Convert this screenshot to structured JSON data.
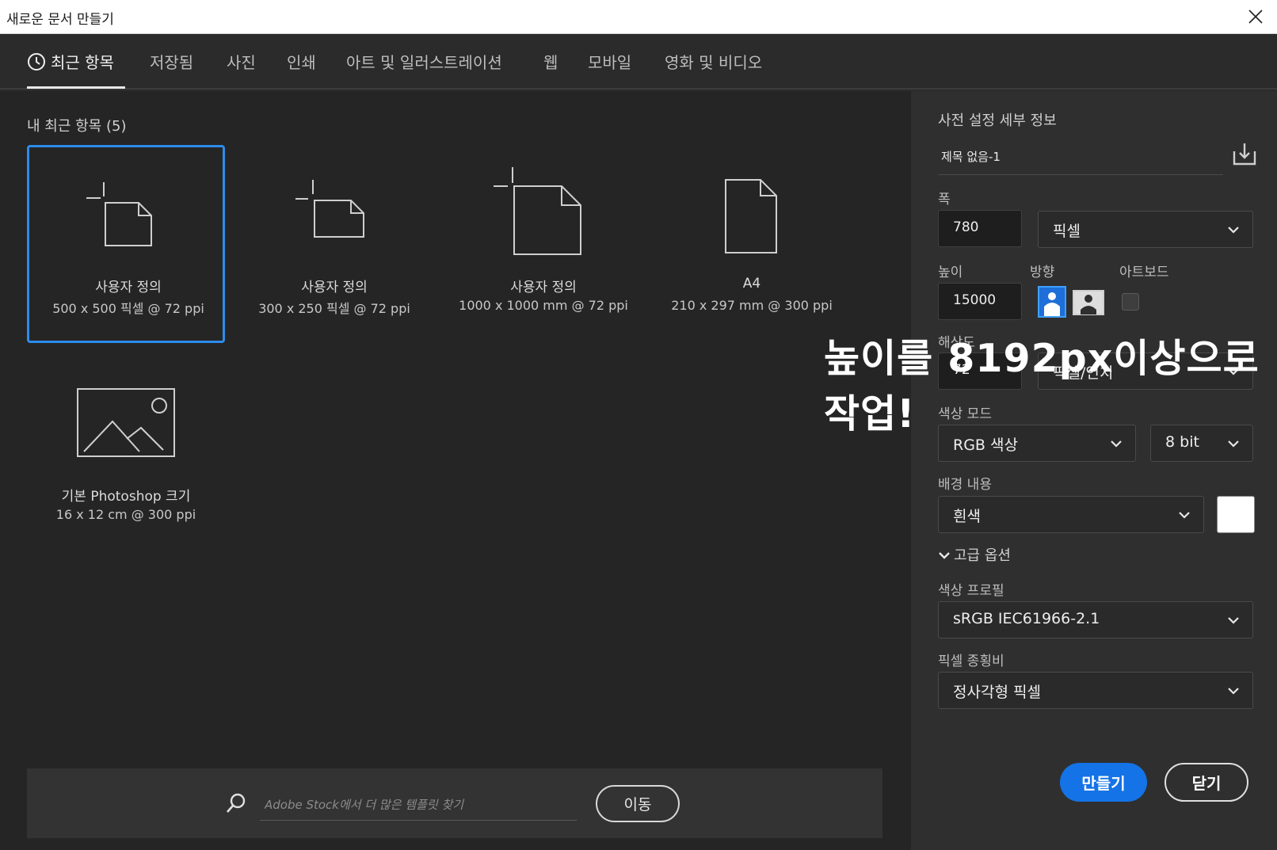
{
  "window": {
    "title": "새로운 문서 만들기"
  },
  "tabs": [
    {
      "label": "최근 항목"
    },
    {
      "label": "저장됨"
    },
    {
      "label": "사진"
    },
    {
      "label": "인쇄"
    },
    {
      "label": "아트 및 일러스트레이션"
    },
    {
      "label": "웹"
    },
    {
      "label": "모바일"
    },
    {
      "label": "영화 및 비디오"
    }
  ],
  "recent": {
    "title": "내 최근 항목 (5)",
    "items": [
      {
        "name": "사용자 정의",
        "spec": "500 x 500 픽셀 @ 72 ppi",
        "icon": "square-doc-icon"
      },
      {
        "name": "사용자 정의",
        "spec": "300 x 250 픽셀 @ 72 ppi",
        "icon": "landscape-doc-icon"
      },
      {
        "name": "사용자 정의",
        "spec": "1000 x 1000 mm @ 72 ppi",
        "icon": "square-doc-icon"
      },
      {
        "name": "A4",
        "spec": "210 x 297 mm @ 300 ppi",
        "icon": "portrait-doc-icon"
      },
      {
        "name": "기본 Photoshop 크기",
        "spec": "16 x 12 cm @ 300 ppi",
        "icon": "image-icon"
      }
    ]
  },
  "search": {
    "placeholder": "Adobe Stock에서 더 많은 템플릿 찾기",
    "go_label": "이동"
  },
  "preset": {
    "title": "사전 설정 세부 정보",
    "name": "제목 없음-1",
    "width_label": "폭",
    "width_value": "780",
    "width_unit": "픽셀",
    "height_label": "높이",
    "height_value": "15000",
    "orientation_label": "방향",
    "artboard_label": "아트보드",
    "resolution_label": "해상도",
    "resolution_value": "72",
    "resolution_unit": "픽셀/인치",
    "color_mode_label": "색상 모드",
    "color_mode_value": "RGB 색상",
    "bit_depth_value": "8 bit",
    "background_label": "배경 내용",
    "background_value": "흰색",
    "background_color": "#ffffff",
    "advanced_label": "고급 옵션",
    "profile_label": "색상 프로필",
    "profile_value": "sRGB IEC61966-2.1",
    "pixel_aspect_label": "픽셀 종횡비",
    "pixel_aspect_value": "정사각형 픽셀",
    "create_label": "만들기",
    "close_label": "닫기"
  },
  "overlay": {
    "line1": "높이를 8192px이상으로",
    "line2": "작업!"
  },
  "colors": {
    "accent": "#1473e6",
    "selection_border": "#2d8ceb"
  }
}
